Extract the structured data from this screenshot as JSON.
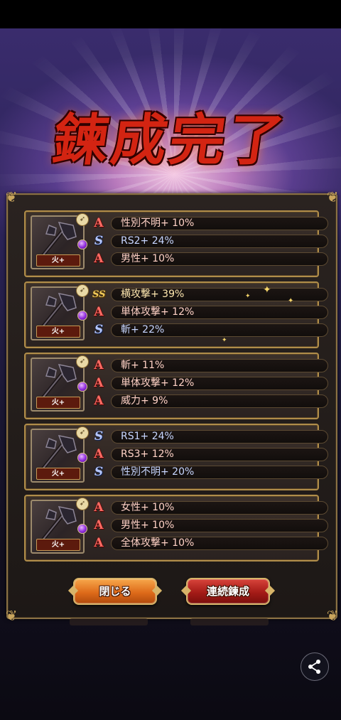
{
  "header": {
    "title": "鍊成完了"
  },
  "results": [
    {
      "element_tag": "火+",
      "stats": [
        {
          "rank": "A",
          "text": "性別不明+ 10%"
        },
        {
          "rank": "S",
          "text": "RS2+ 24%"
        },
        {
          "rank": "A",
          "text": "男性+ 10%"
        }
      ]
    },
    {
      "element_tag": "火+",
      "stats": [
        {
          "rank": "SS",
          "text": "横攻撃+ 39%"
        },
        {
          "rank": "A",
          "text": "単体攻撃+ 12%"
        },
        {
          "rank": "S",
          "text": "斬+ 22%"
        }
      ]
    },
    {
      "element_tag": "火+",
      "stats": [
        {
          "rank": "A",
          "text": "斬+ 11%"
        },
        {
          "rank": "A",
          "text": "単体攻撃+ 12%"
        },
        {
          "rank": "A",
          "text": "威力+ 9%"
        }
      ]
    },
    {
      "element_tag": "火+",
      "stats": [
        {
          "rank": "S",
          "text": "RS1+ 24%"
        },
        {
          "rank": "A",
          "text": "RS3+ 12%"
        },
        {
          "rank": "S",
          "text": "性別不明+ 20%"
        }
      ]
    },
    {
      "element_tag": "火+",
      "stats": [
        {
          "rank": "A",
          "text": "女性+ 10%"
        },
        {
          "rank": "A",
          "text": "男性+ 10%"
        },
        {
          "rank": "A",
          "text": "全体攻撃+ 10%"
        }
      ]
    }
  ],
  "rank_glyphs": {
    "A": "A",
    "S": "S",
    "SS": "SS"
  },
  "buttons": {
    "close_label": "閉じる",
    "continue_label": "連続鍊成"
  },
  "icons": {
    "share": "share-icon",
    "weapon": "axe-weapon-icon",
    "gem": "purple-gem-icon"
  },
  "colors": {
    "rank_A": "#ff6b63",
    "rank_S": "#b4c6ff",
    "rank_SS": "#f1cb5c",
    "frame_gold": "#b08d4a"
  }
}
